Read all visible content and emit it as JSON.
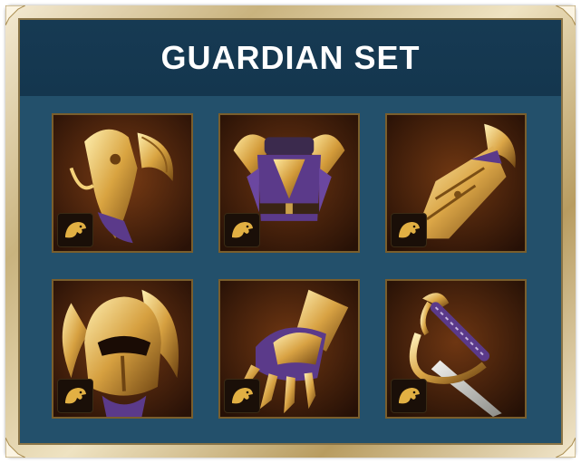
{
  "header": {
    "title": "GUARDIAN SET"
  },
  "set_icon": "gold-eagle-head-icon",
  "items": [
    {
      "slot": "shoulders",
      "icon": "shoulder-armor-icon"
    },
    {
      "slot": "chest",
      "icon": "chest-armor-icon"
    },
    {
      "slot": "bracers",
      "icon": "bracer-icon"
    },
    {
      "slot": "helmet",
      "icon": "helmet-icon"
    },
    {
      "slot": "gloves",
      "icon": "gauntlet-icon"
    },
    {
      "slot": "weapon",
      "icon": "sabre-icon"
    }
  ],
  "colors": {
    "panel": "#23506b",
    "title_band": "#163a53",
    "gold": "#d9a441",
    "purple": "#5b3a8a"
  }
}
